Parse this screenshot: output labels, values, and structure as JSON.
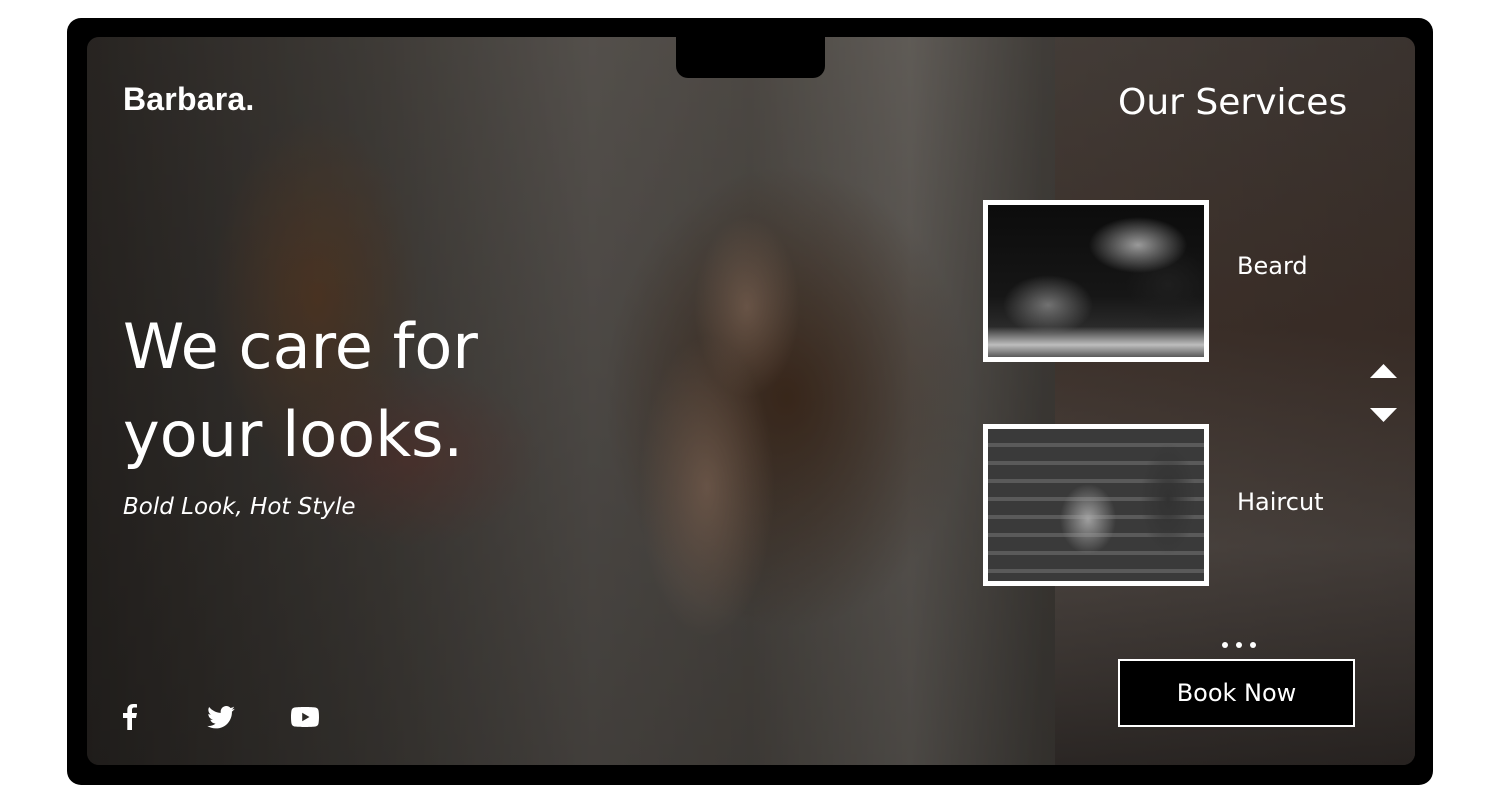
{
  "brand": {
    "logo": "Barbara."
  },
  "hero": {
    "headline_line1": "We care for",
    "headline_line2": "your looks.",
    "tagline": "Bold Look, Hot Style"
  },
  "social": [
    {
      "icon": "facebook-icon"
    },
    {
      "icon": "twitter-icon"
    },
    {
      "icon": "youtube-icon"
    }
  ],
  "services": {
    "title": "Our Services",
    "items": [
      {
        "label": "Beard",
        "image": "beard-trim-photo"
      },
      {
        "label": "Haircut",
        "image": "child-haircut-photo"
      }
    ],
    "pagination_dots": 3
  },
  "cta": {
    "book_label": "Book Now"
  },
  "colors": {
    "text": "#ffffff",
    "button_bg": "#000000",
    "frame": "#000000"
  }
}
